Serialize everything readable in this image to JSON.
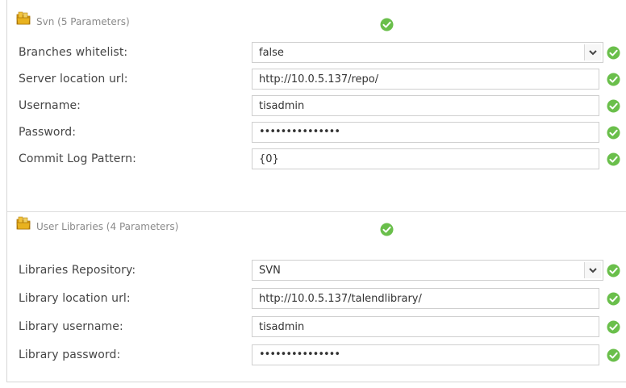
{
  "colors": {
    "ok_green": "#6abf4b",
    "folder_yellow": "#e8b21f",
    "label_gray": "#8a8a8a"
  },
  "icons": {
    "section": "folder-icon",
    "status": "check-circle-icon",
    "dropdown": "chevron-down-icon"
  },
  "svn": {
    "title": "Svn (5 Parameters)",
    "rows": [
      {
        "label": "Branches whitelist:",
        "value": "false",
        "type": "select"
      },
      {
        "label": "Server location url:",
        "value": "http://10.0.5.137/repo/",
        "type": "text"
      },
      {
        "label": "Username:",
        "value": "tisadmin",
        "type": "text"
      },
      {
        "label": "Password:",
        "value": "•••••••••••••••",
        "type": "password"
      },
      {
        "label": "Commit Log Pattern:",
        "value": "{0}",
        "type": "text"
      }
    ]
  },
  "user_libraries": {
    "title": "User Libraries (4 Parameters)",
    "rows": [
      {
        "label": "Libraries Repository:",
        "value": "SVN",
        "type": "select"
      },
      {
        "label": "Library location url:",
        "value": "http://10.0.5.137/talendlibrary/",
        "type": "text"
      },
      {
        "label": "Library username:",
        "value": "tisadmin",
        "type": "text"
      },
      {
        "label": "Library password:",
        "value": "•••••••••••••••",
        "type": "password"
      }
    ]
  }
}
